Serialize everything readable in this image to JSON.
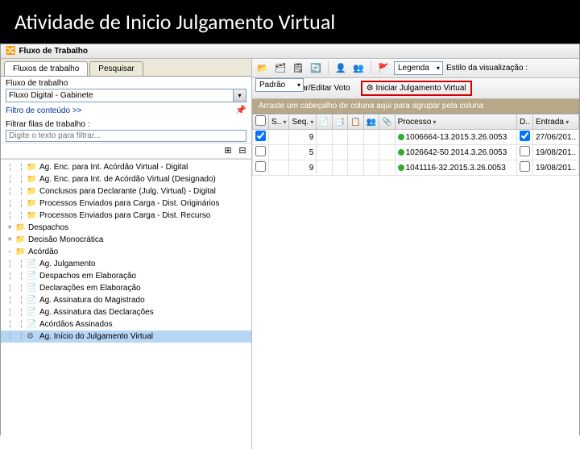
{
  "title": "Atividade de Inicio Julgamento Virtual",
  "panel_header": "Fluxo de Trabalho",
  "tabs": {
    "workflow": "Fluxos de trabalho",
    "search": "Pesquisar"
  },
  "workflow_label": "Fluxo de trabalho",
  "workflow_value": "Fluxo Digital - Gabinete",
  "filter_link": "Filtro de conteúdo >>",
  "filter_queues_label": "Filtrar filas de trabalho :",
  "filter_queues_placeholder": "Digite o texto para filtrar...",
  "tree": {
    "level2": [
      "Ag. Enc. para Int. Acórdão Virtual - Digital",
      "Ag. Enc. para Int. de Acórdão Virtual (Designado)",
      "Conclusos para Declarante (Julg. Virtual) - Digital",
      "Processos Enviados para Carga - Dist. Originários",
      "Processos Enviados para Carga - Dist. Recurso"
    ],
    "nodes": [
      {
        "label": "Despachos",
        "expand": "+"
      },
      {
        "label": "Decisão Monocrática",
        "expand": "+"
      },
      {
        "label": "Acórdão",
        "expand": "-"
      }
    ],
    "acordao_children": [
      "Ag. Julgamento",
      "Despachos em Elaboração",
      "Declarações em Elaboração",
      "Ag. Assinatura do Magistrado",
      "Ag. Assinatura das Declarações",
      "Acórdãos Assinados"
    ],
    "selected": "Ag. Início do Julgamento Virtual"
  },
  "top_toolbar": {
    "legend": "Legenda",
    "style_label": "Estilo da visualização :",
    "style_value": "Padrão"
  },
  "action_btns": {
    "view_vote": "Visualizar/Editar Voto",
    "start_virtual": "Iniciar Julgamento Virtual"
  },
  "group_strip": "Arraste um cabeçalho de coluna aqui para agrupar pela coluna",
  "grid": {
    "headers": {
      "situacao": "S..",
      "seq": "Seq.",
      "processo": "Processo",
      "d": "D..",
      "entrada": "Entrada"
    },
    "rows": [
      {
        "chk": true,
        "seq": "9",
        "processo": "1006664-13.2015.3.26.0053",
        "entrada": "27/06/201.."
      },
      {
        "chk": false,
        "seq": "5",
        "processo": "1026642-50.2014.3.26.0053",
        "entrada": "19/08/201.."
      },
      {
        "chk": false,
        "seq": "9",
        "processo": "1041116-32.2015.3.26.0053",
        "entrada": "19/08/201.."
      }
    ]
  }
}
